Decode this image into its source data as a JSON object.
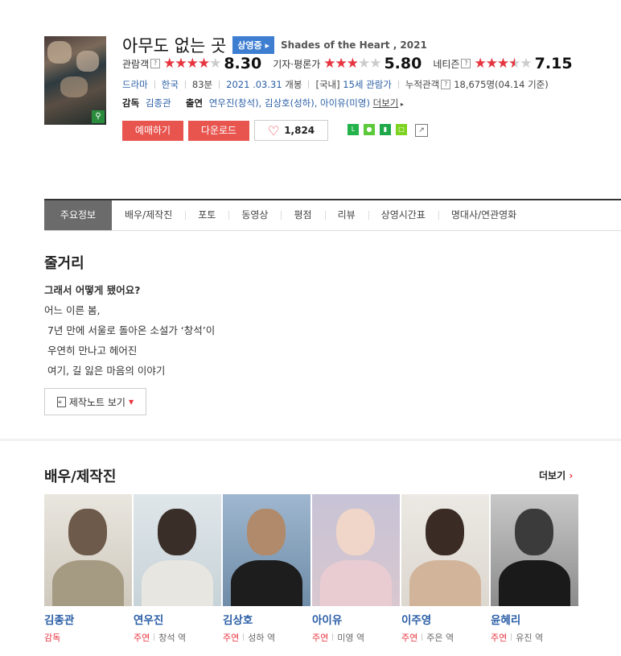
{
  "movie": {
    "title": "아무도 없는 곳",
    "status_badge": "상영중",
    "english_title": "Shades of the Heart , 2021",
    "ratings": [
      {
        "label": "관람객",
        "score": "8.30",
        "fraction": 0.83
      },
      {
        "label": "기자·평론가",
        "score": "5.80",
        "fraction": 0.58
      },
      {
        "label": "네티즌",
        "score": "7.15",
        "fraction": 0.715
      }
    ],
    "genre": "드라마",
    "country": "한국",
    "runtime": "83분",
    "release_date": "2021 .03.31",
    "release_suffix": "개봉",
    "age_prefix": "[국내]",
    "age_rating": "15세 관람가",
    "cumulative_label": "누적관객",
    "cumulative_value": "18,675명(04.14 기준)",
    "director_label": "감독",
    "director": "김종관",
    "cast_label": "출연",
    "cast_text": "연우진(창석), 김상호(성하), 아이유(미영)",
    "cast_more": "더보기"
  },
  "buttons": {
    "reserve": "예매하기",
    "download": "다운로드",
    "like_count": "1,824"
  },
  "tabs": [
    "주요정보",
    "배우/제작진",
    "포토",
    "동영상",
    "평점",
    "리뷰",
    "상영시간표",
    "명대사/연관영화"
  ],
  "synopsis": {
    "heading": "줄거리",
    "subtitle": "그래서 어떻게 됐어요?",
    "lines": [
      "어느 이른 봄,",
      " 7년 만에 서울로 돌아온 소설가 ‘창석’이",
      " 우연히 만나고 헤어진",
      " 여기, 길 잃은 마음의 이야기"
    ],
    "note_button": "제작노트 보기"
  },
  "cast_section": {
    "heading": "배우/제작진",
    "more": "더보기",
    "people": [
      {
        "name": "김종관",
        "role": "감독",
        "character": ""
      },
      {
        "name": "연우진",
        "role": "주연",
        "character": "창석 역"
      },
      {
        "name": "김상호",
        "role": "주연",
        "character": "성하 역"
      },
      {
        "name": "아이유",
        "role": "주연",
        "character": "미영 역"
      },
      {
        "name": "이주영",
        "role": "주연",
        "character": "주은 역"
      },
      {
        "name": "윤혜리",
        "role": "주연",
        "character": "유진 역"
      }
    ]
  }
}
